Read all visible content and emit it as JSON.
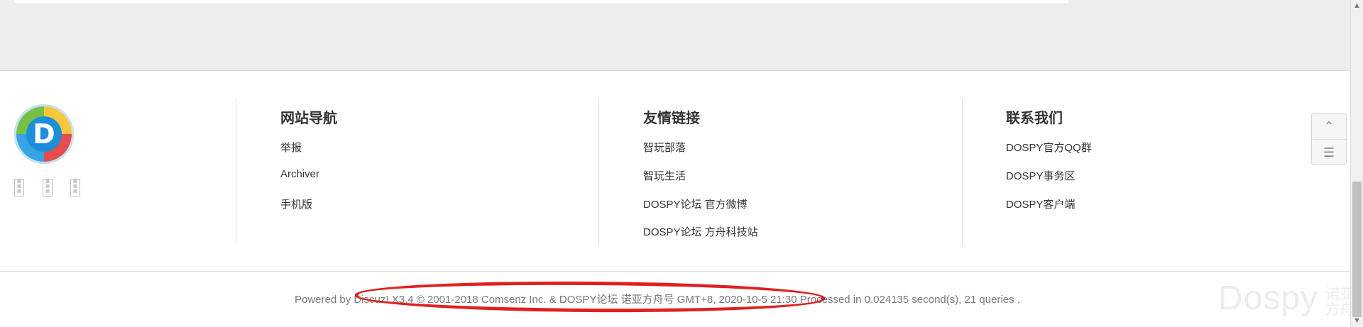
{
  "footer": {
    "columns": [
      {
        "title": "网站导航",
        "links": [
          "举报",
          "Archiver",
          "手机版"
        ]
      },
      {
        "title": "友情链接",
        "links": [
          "智玩部落",
          "智玩生活",
          "DOSPY论坛 官方微博",
          "DOSPY论坛 方舟科技站"
        ]
      },
      {
        "title": "联系我们",
        "links": [
          "DOSPY官方QQ群",
          "DOSPY事务区",
          "DOSPY客户端"
        ]
      }
    ],
    "logo": {
      "letter": "D"
    },
    "qr_icons": [
      "qr-code-icon",
      "qr-code-icon",
      "qr-code-icon"
    ],
    "powered_text": "Powered by Discuz! X3.4 © 2001-2018 Comsenz Inc. & DOSPY论坛 诺亚方舟号 GMT+8, 2020-10-5 21:30 Processed in 0.024135 second(s), 21 queries .",
    "watermark": {
      "brand": "Dospy",
      "side": "诺亚方舟"
    }
  },
  "side_tools": {
    "items": [
      "back-to-top-icon",
      "list-icon"
    ]
  },
  "colors": {
    "annotation": "#e02020",
    "footer_text": "#333333",
    "muted_text": "#777777",
    "divider": "#dddddd"
  }
}
